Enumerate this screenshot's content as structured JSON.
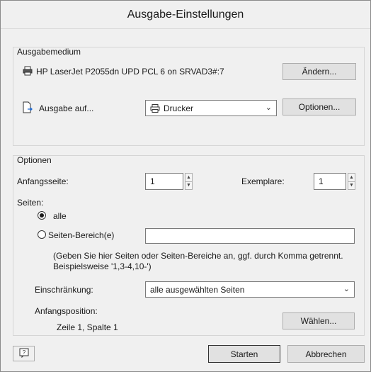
{
  "window": {
    "title": "Ausgabe-Einstellungen"
  },
  "output_medium": {
    "group_label": "Ausgabemedium",
    "printer_icon": "printer-icon",
    "printer_name": "HP LaserJet P2055dn UPD PCL 6 on SRVAD3#:7",
    "change_button": "Ändern...",
    "output_to_icon": "page-arrow-icon",
    "output_to_label": "Ausgabe auf...",
    "destination_icon": "printer-icon",
    "destination_value": "Drucker",
    "options_button": "Optionen..."
  },
  "options": {
    "group_label": "Optionen",
    "start_page_label": "Anfangsseite:",
    "start_page_value": "1",
    "copies_label": "Exemplare:",
    "copies_value": "1",
    "pages_label": "Seiten:",
    "radio_all_label": "alle",
    "radio_all_checked": true,
    "radio_range_label": "Seiten-Bereich(e)",
    "range_value": "",
    "range_hint_line1": "(Geben Sie hier Seiten oder Seiten-Bereiche an, ggf. durch Komma getrennt.",
    "range_hint_line2": "Beispielsweise '1,3-4,10-')",
    "restriction_label": "Einschränkung:",
    "restriction_value": "alle ausgewählten Seiten",
    "start_position_label": "Anfangsposition:",
    "start_position_value": "Zeile 1, Spalte 1",
    "choose_button": "Wählen..."
  },
  "footer": {
    "help_icon": "help-icon",
    "start_button": "Starten",
    "cancel_button": "Abbrechen"
  }
}
